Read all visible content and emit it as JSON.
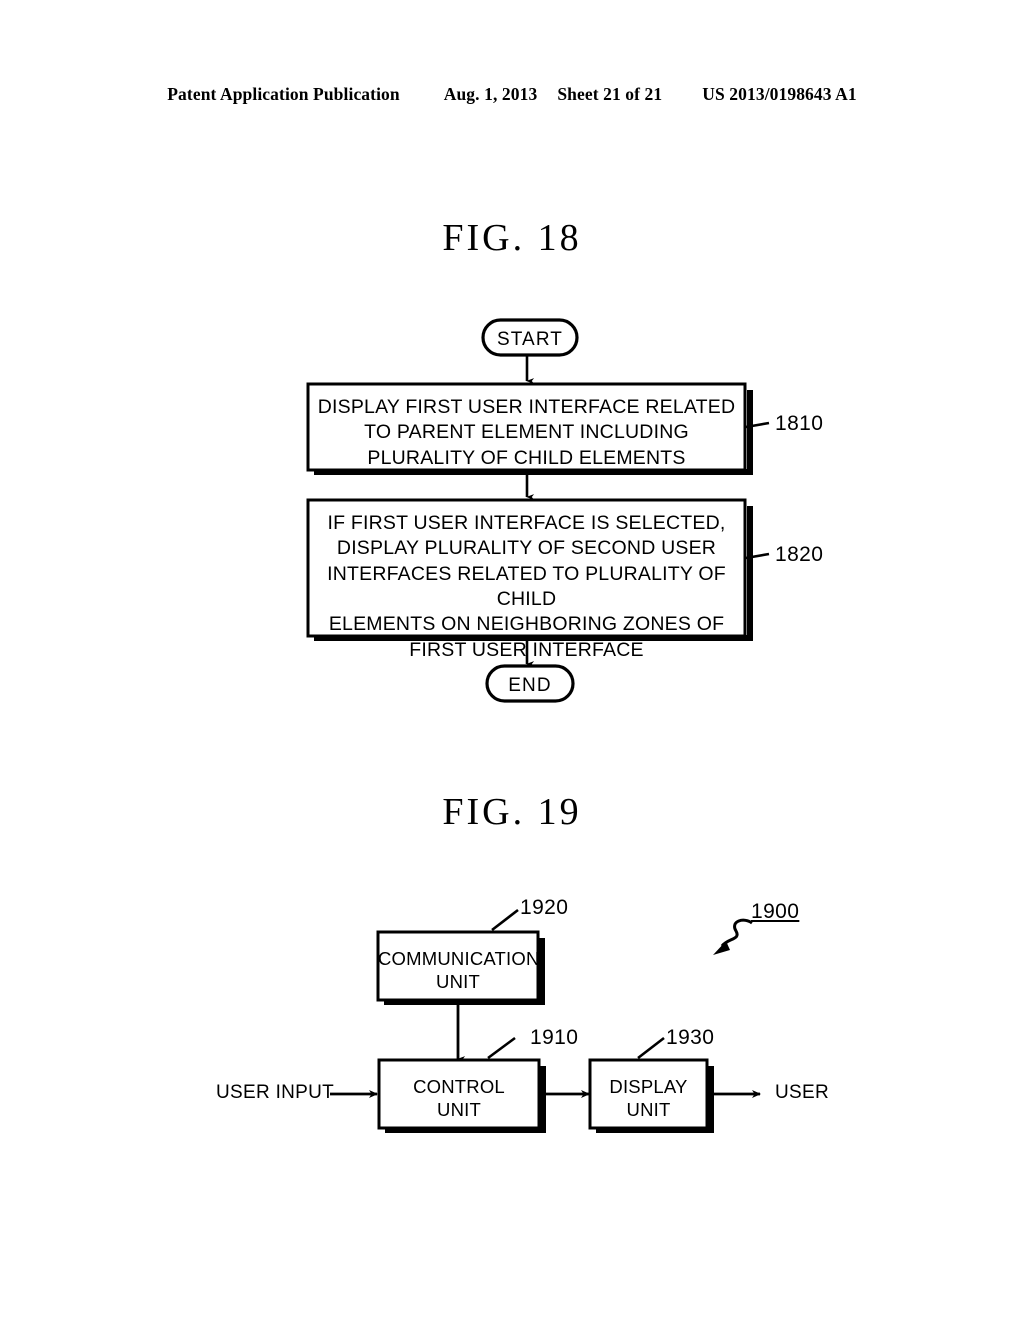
{
  "header": {
    "publication": "Patent Application Publication",
    "date": "Aug. 1, 2013",
    "sheet": "Sheet 21 of 21",
    "patent_number": "US 2013/0198643 A1"
  },
  "figures": [
    {
      "title": "FIG.  18",
      "type": "flowchart",
      "nodes": [
        {
          "id": "start",
          "shape": "terminal",
          "label": "START"
        },
        {
          "id": "1810",
          "shape": "process",
          "ref": "1810",
          "label": "DISPLAY FIRST USER INTERFACE RELATED\nTO PARENT ELEMENT INCLUDING\nPLURALITY OF CHILD ELEMENTS"
        },
        {
          "id": "1820",
          "shape": "process",
          "ref": "1820",
          "label": "IF FIRST USER INTERFACE IS SELECTED,\nDISPLAY PLURALITY OF SECOND USER\nINTERFACES RELATED TO PLURALITY OF CHILD\nELEMENTS ON NEIGHBORING ZONES OF\nFIRST USER INTERFACE"
        },
        {
          "id": "end",
          "shape": "terminal",
          "label": "END"
        }
      ]
    },
    {
      "title": "FIG.  19",
      "type": "block-diagram",
      "system_ref": "1900",
      "blocks": [
        {
          "id": "1920",
          "ref": "1920",
          "label": "COMMUNICATION\nUNIT"
        },
        {
          "id": "1910",
          "ref": "1910",
          "label": "CONTROL\nUNIT"
        },
        {
          "id": "1930",
          "ref": "1930",
          "label": "DISPLAY\nUNIT"
        }
      ],
      "io_labels": [
        {
          "id": "user-input",
          "label": "USER INPUT"
        },
        {
          "id": "user-output",
          "label": "USER"
        }
      ]
    }
  ],
  "colors": {
    "ink": "#000000",
    "paper": "#ffffff"
  }
}
